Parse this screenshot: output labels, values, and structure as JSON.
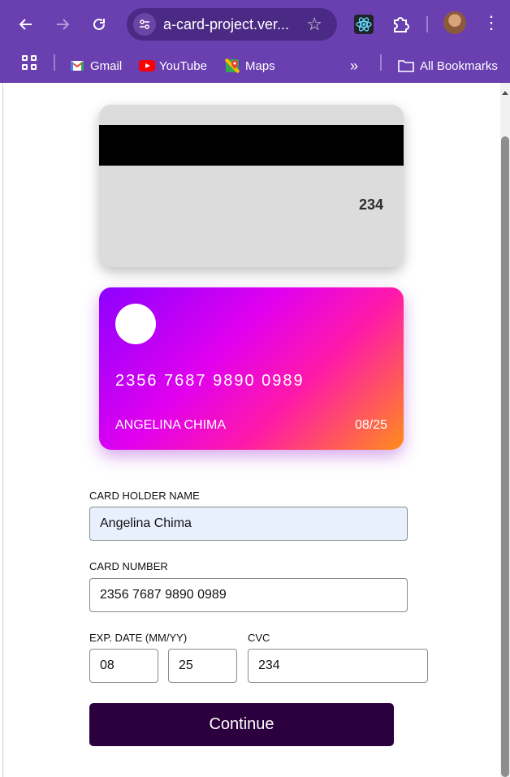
{
  "browser": {
    "url": "a-card-project.ver...",
    "bookmarks": [
      {
        "label": "Gmail",
        "icon": "gmail-icon"
      },
      {
        "label": "YouTube",
        "icon": "youtube-icon"
      },
      {
        "label": "Maps",
        "icon": "maps-icon"
      }
    ],
    "more": "»",
    "all_bookmarks": "All Bookmarks"
  },
  "card_back": {
    "cvc": "234"
  },
  "card_front": {
    "number": "2356 7687 9890 0989",
    "holder": "ANGELINA CHIMA",
    "expiry": "08/25"
  },
  "form": {
    "holder_label": "CARD HOLDER NAME",
    "holder_value": "Angelina Chima",
    "number_label": "CARD NUMBER",
    "number_value": "2356 7687 9890 0989",
    "exp_label": "EXP. DATE (MM/YY)",
    "exp_month": "08",
    "exp_year": "25",
    "cvc_label": "CVC",
    "cvc_value": "234",
    "submit_label": "Continue"
  },
  "colors": {
    "browser_bg": "#6a3fb0",
    "button_bg": "#2c003e",
    "card_gradient_start": "#8d00ff",
    "card_gradient_end": "#ff8d1a"
  }
}
